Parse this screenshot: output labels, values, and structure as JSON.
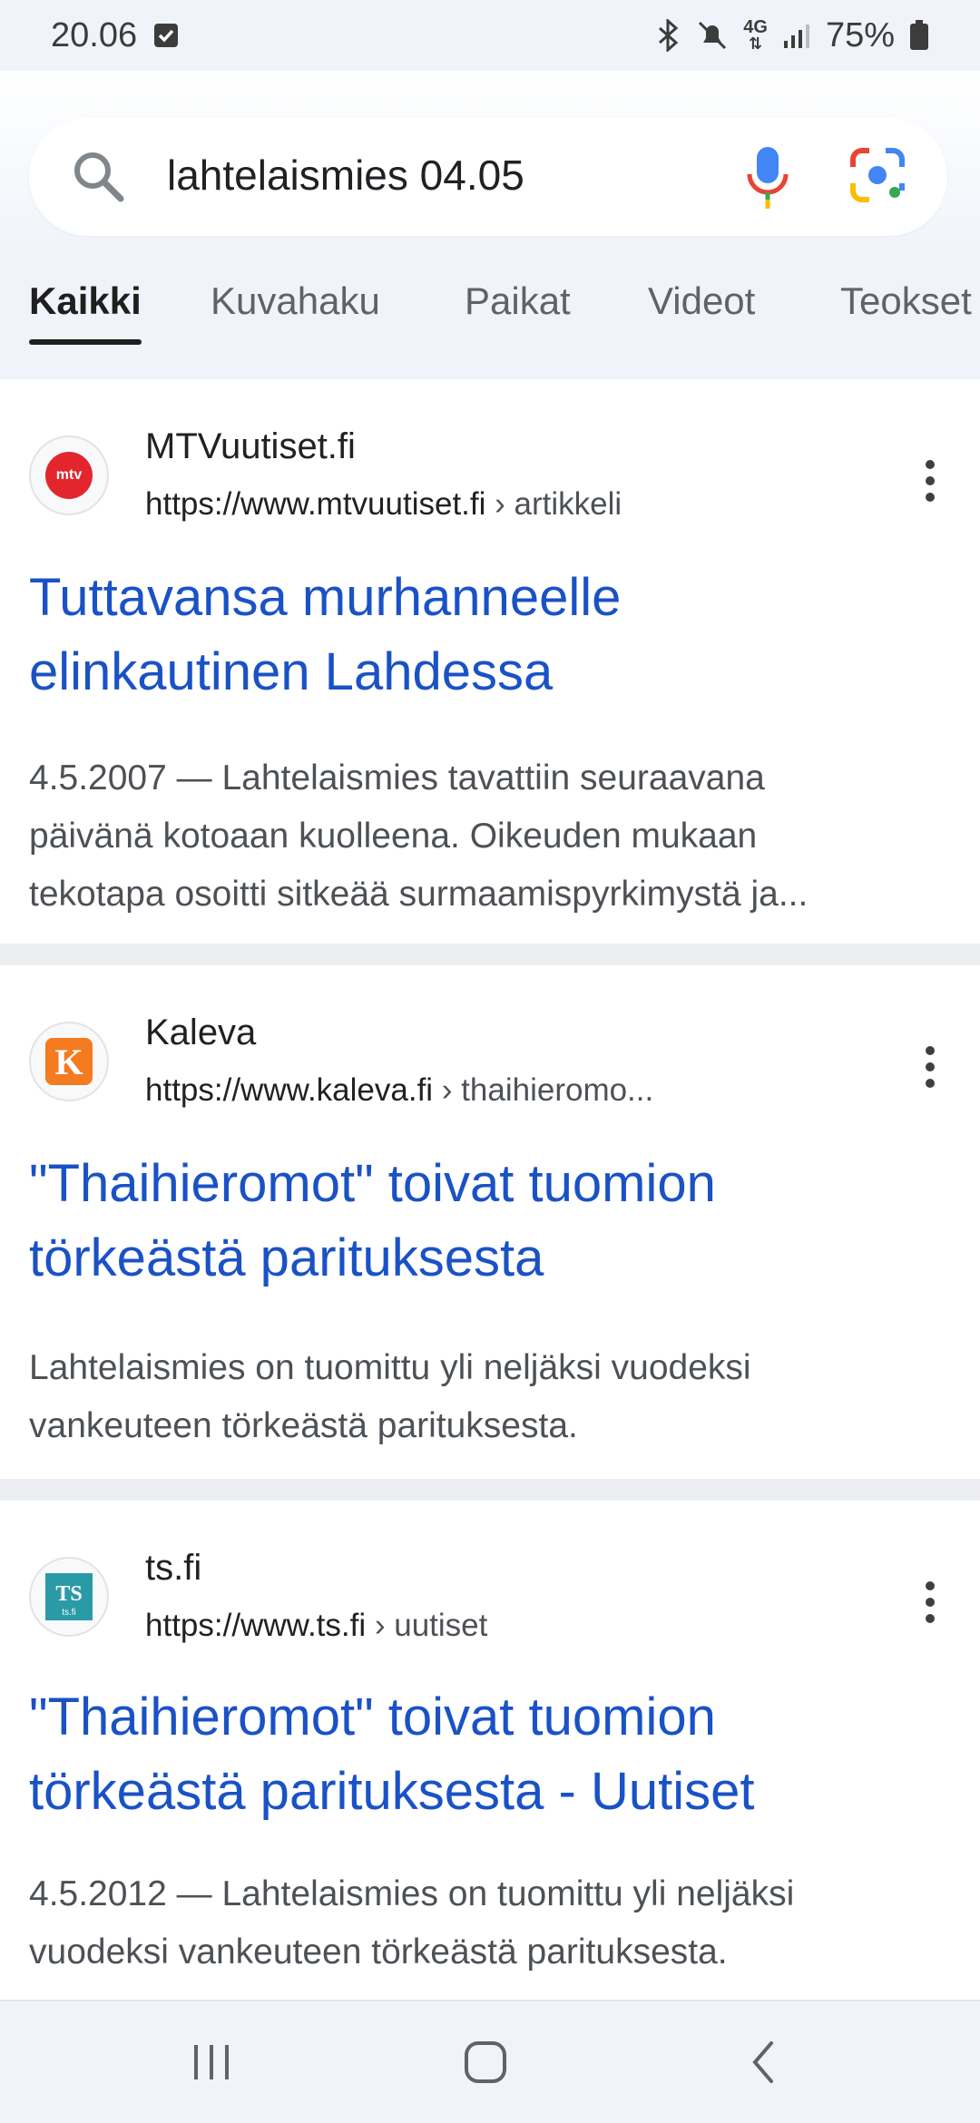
{
  "status_bar": {
    "time": "20.06",
    "battery": "75%",
    "network": "4G"
  },
  "search": {
    "query": "lahtelaismies 04.05"
  },
  "tabs": [
    {
      "label": "Kaikki",
      "active": true
    },
    {
      "label": "Kuvahaku",
      "active": false
    },
    {
      "label": "Paikat",
      "active": false
    },
    {
      "label": "Videot",
      "active": false
    },
    {
      "label": "Teokset",
      "active": false
    }
  ],
  "results": [
    {
      "site_name": "MTVuutiset.fi",
      "url": "https://www.mtvuutiset.fi",
      "crumb": " › artikkeli",
      "favicon_text": "mtv",
      "favicon_color": "#e3262e",
      "title_line1": "Tuttavansa murhanneelle",
      "title_line2": "elinkautinen Lahdessa",
      "snippet_line1": "4.5.2007 — Lahtelaismies tavattiin seuraavana",
      "snippet_line2": "päivänä kotoaan kuolleena. Oikeuden mukaan",
      "snippet_line3": "tekotapa osoitti sitkeää surmaamispyrkimystä ja..."
    },
    {
      "site_name": "Kaleva",
      "url": "https://www.kaleva.fi",
      "crumb": " › thaihieromo...",
      "favicon_text": "K",
      "favicon_color": "#f47b20",
      "title_line1": "\"Thaihieromot\" toivat tuomion",
      "title_line2": "törkeästä parituksesta",
      "snippet_line1": "Lahtelaismies on tuomittu yli neljäksi vuodeksi",
      "snippet_line2": "vankeuteen törkeästä parituksesta."
    },
    {
      "site_name": "ts.fi",
      "url": "https://www.ts.fi",
      "crumb": " › uutiset",
      "favicon_text": "TS",
      "favicon_color": "#2a9ba6",
      "title_line1": "\"Thaihieromot\" toivat tuomion",
      "title_line2": "törkeästä parituksesta - Uutiset",
      "snippet_line1": "4.5.2012 — Lahtelaismies on tuomittu yli neljäksi",
      "snippet_line2": "vuodeksi vankeuteen törkeästä parituksesta."
    }
  ],
  "colors": {
    "link_blue": "#1a52c6",
    "header_bg": "#f0f4fa"
  }
}
